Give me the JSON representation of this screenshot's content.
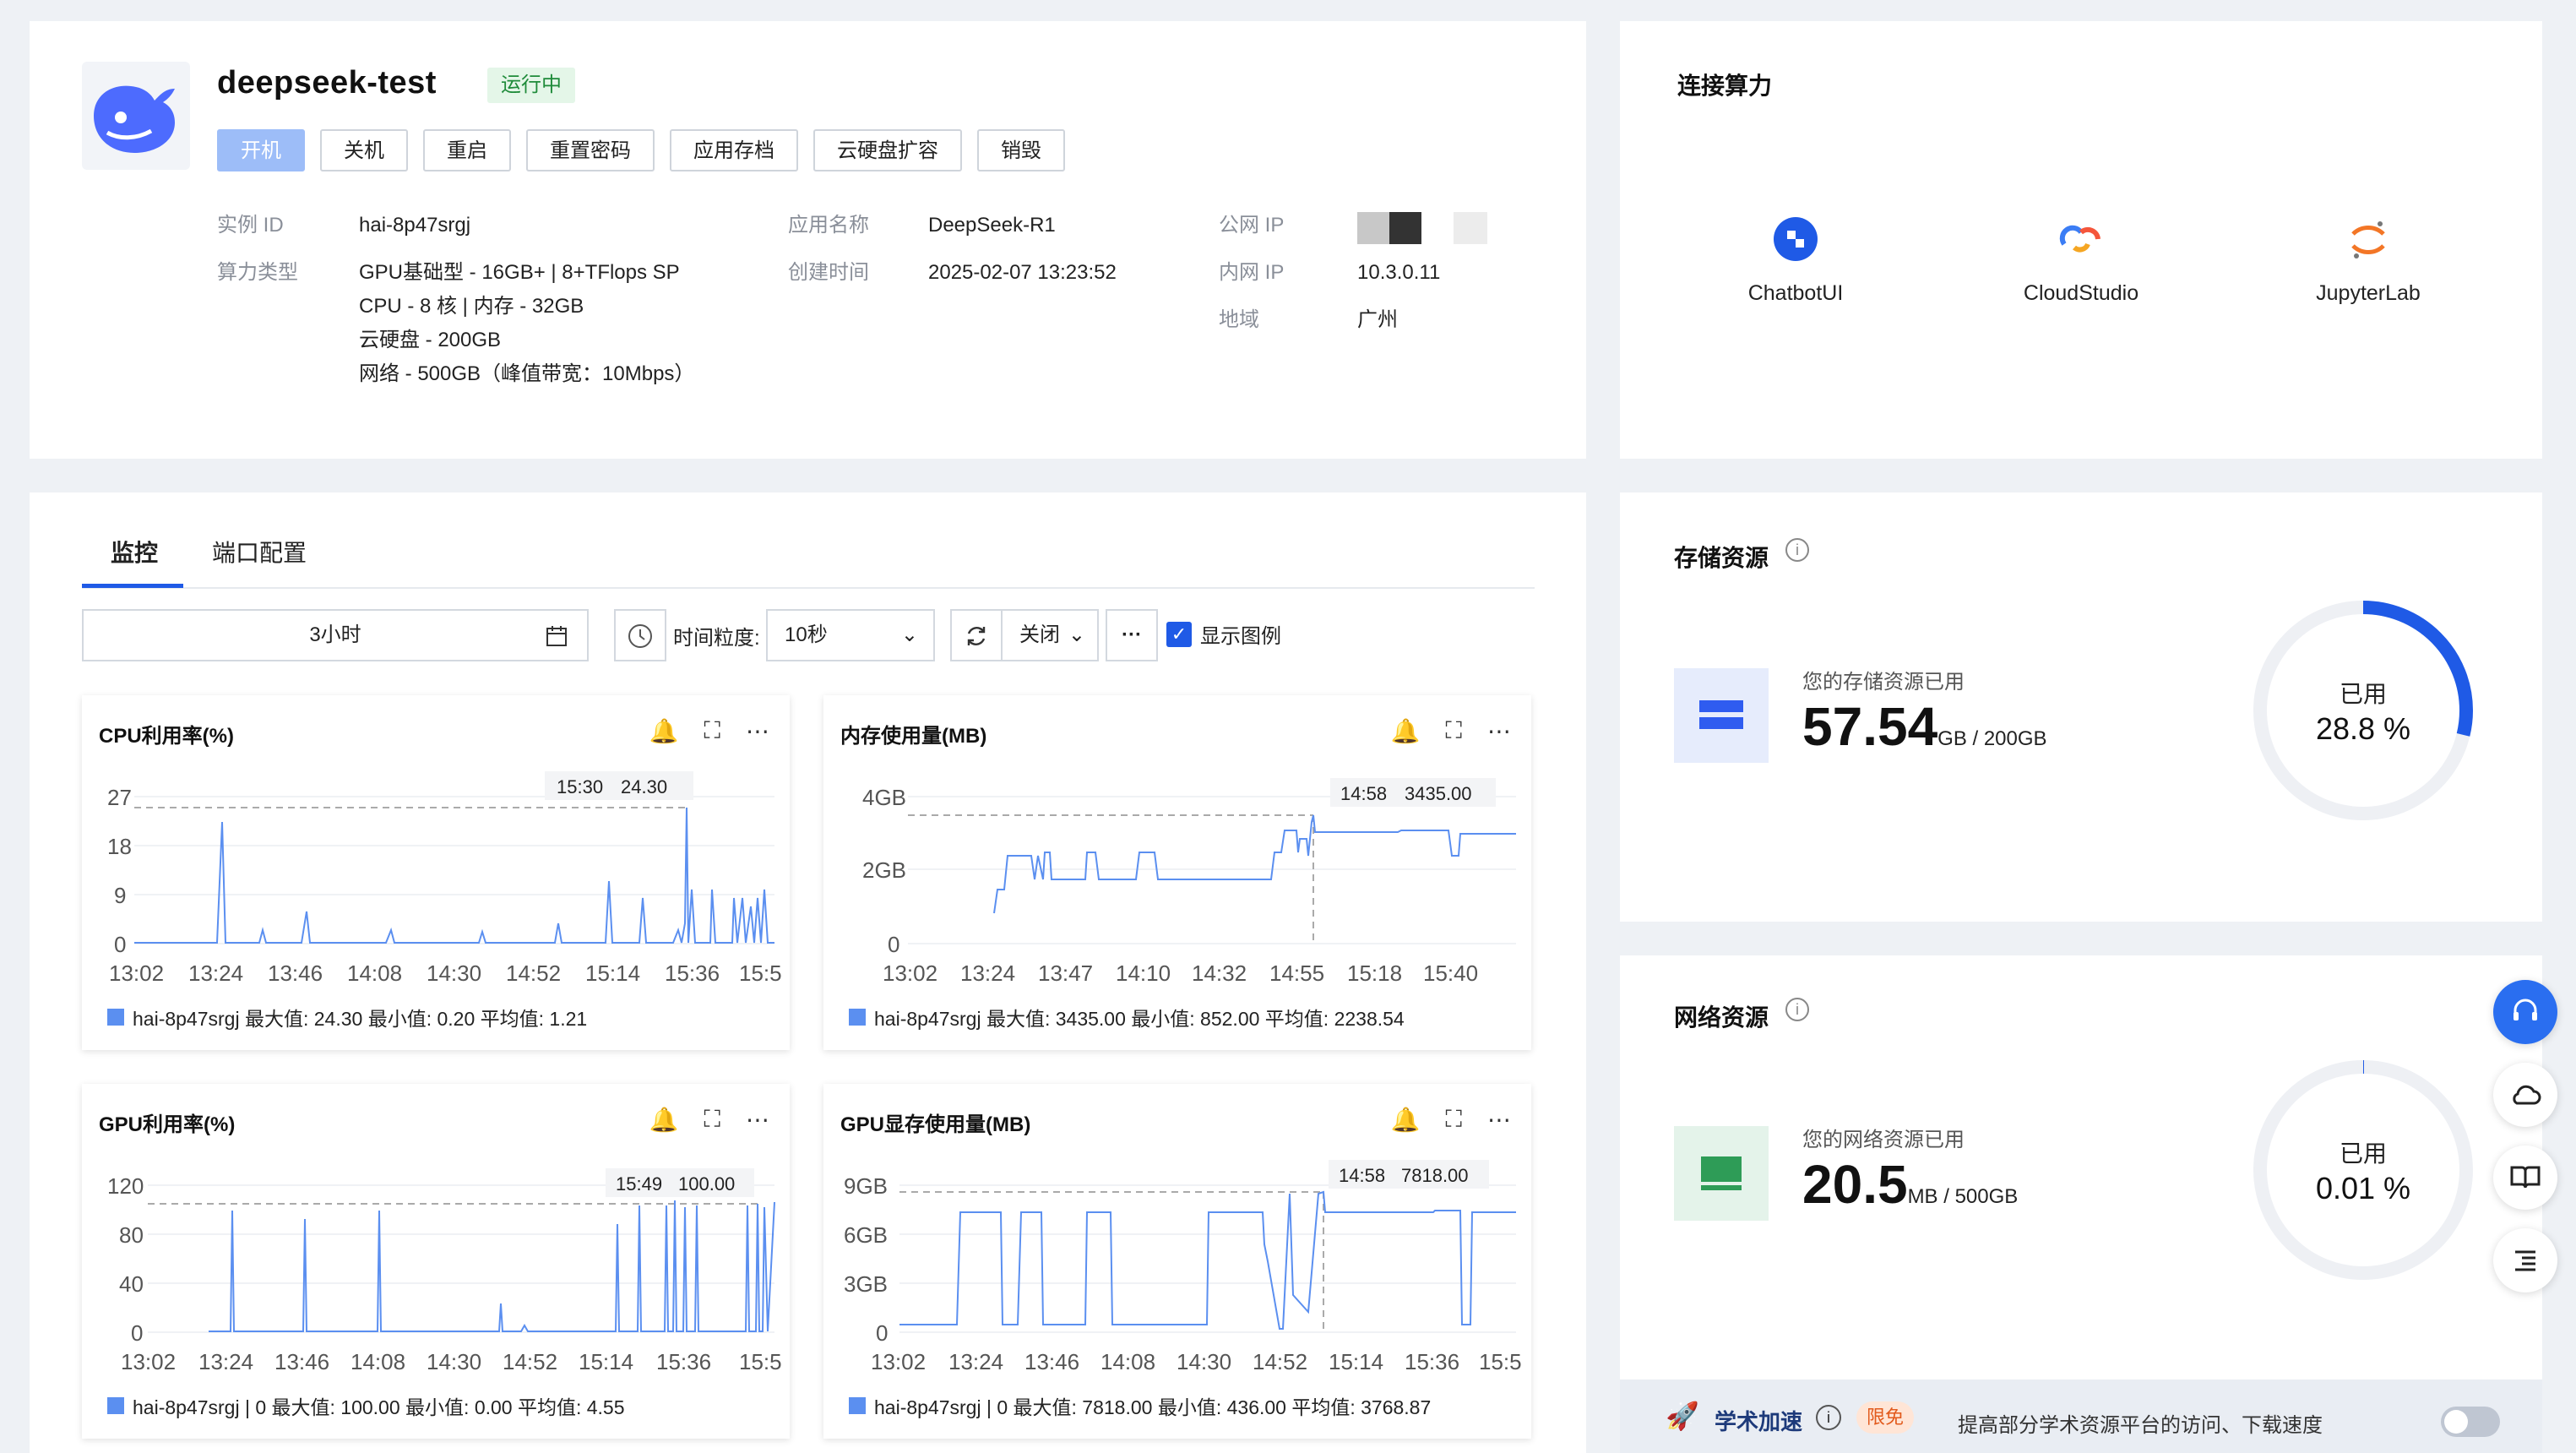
{
  "instance": {
    "name": "deepseek-test",
    "status": "运行中",
    "buttons": [
      "开机",
      "关机",
      "重启",
      "重置密码",
      "应用存档",
      "云硬盘扩容",
      "销毁"
    ],
    "labels": {
      "id": "实例 ID",
      "type": "算力类型",
      "app": "应用名称",
      "created": "创建时间",
      "public_ip": "公网 IP",
      "private_ip": "内网 IP",
      "region": "地域"
    },
    "values": {
      "id": "hai-8p47srgj",
      "type_lines": [
        "GPU基础型 - 16GB+ | 8+TFlops SP",
        "CPU - 8 核 | 内存 - 32GB",
        "云硬盘 - 200GB",
        "网络 - 500GB（峰值带宽：10Mbps）"
      ],
      "app": "DeepSeek-R1",
      "created": "2025-02-07 13:23:52",
      "private_ip": "10.3.0.11",
      "region": "广州"
    }
  },
  "connect": {
    "title": "连接算力",
    "apps": [
      {
        "label": "ChatbotUI",
        "icon": "chatbotui-icon"
      },
      {
        "label": "CloudStudio",
        "icon": "cloudstudio-icon"
      },
      {
        "label": "JupyterLab",
        "icon": "jupyter-icon"
      }
    ]
  },
  "monitor": {
    "tabs": [
      "监控",
      "端口配置"
    ],
    "range": "3小时",
    "granularity_label": "时间粒度:",
    "granularity": "10秒",
    "refresh": "关闭",
    "more": "···",
    "show_legend": "显示图例"
  },
  "charts": [
    {
      "title": "CPU利用率(%)",
      "tooltip_time": "15:30",
      "tooltip_value": "24.30",
      "legend": "hai-8p47srgj  最大值: 24.30  最小值: 0.20  平均值: 1.21",
      "yticks": [
        "27",
        "18",
        "9",
        "0"
      ],
      "xticks": [
        "13:02",
        "13:24",
        "13:46",
        "14:08",
        "14:30",
        "14:52",
        "15:14",
        "15:36",
        "15:5"
      ]
    },
    {
      "title": "内存使用量(MB)",
      "tooltip_time": "14:58",
      "tooltip_value": "3435.00",
      "legend": "hai-8p47srgj  最大值: 3435.00  最小值: 852.00  平均值: 2238.54",
      "yticks": [
        "4GB",
        "2GB",
        "0"
      ],
      "xticks": [
        "13:02",
        "13:24",
        "13:47",
        "14:10",
        "14:32",
        "14:55",
        "15:18",
        "15:40"
      ]
    },
    {
      "title": "GPU利用率(%)",
      "tooltip_time": "15:49",
      "tooltip_value": "100.00",
      "legend": "hai-8p47srgj | 0  最大值: 100.00  最小值: 0.00  平均值: 4.55",
      "yticks": [
        "120",
        "80",
        "40",
        "0"
      ],
      "xticks": [
        "13:02",
        "13:24",
        "13:46",
        "14:08",
        "14:30",
        "14:52",
        "15:14",
        "15:36",
        "15:5"
      ]
    },
    {
      "title": "GPU显存使用量(MB)",
      "tooltip_time": "14:58",
      "tooltip_value": "7818.00",
      "legend": "hai-8p47srgj | 0  最大值: 7818.00  最小值: 436.00  平均值: 3768.87",
      "yticks": [
        "9GB",
        "6GB",
        "3GB",
        "0"
      ],
      "xticks": [
        "13:02",
        "13:24",
        "13:46",
        "14:08",
        "14:30",
        "14:52",
        "15:14",
        "15:36",
        "15:5"
      ]
    }
  ],
  "storage": {
    "title": "存储资源",
    "caption": "您的存储资源已用",
    "value": "57.54",
    "unit": "GB / 200GB",
    "used_label": "已用",
    "percent": "28.8 %",
    "fraction": 0.288
  },
  "network": {
    "title": "网络资源",
    "caption": "您的网络资源已用",
    "value": "20.5",
    "unit": "MB / 500GB",
    "used_label": "已用",
    "percent": "0.01 %",
    "fraction": 0.0001
  },
  "accel": {
    "title": "学术加速",
    "badge": "限免",
    "desc": "提高部分学术资源平台的访问、下载速度"
  },
  "colors": {
    "primary": "#1f5ae6",
    "line": "#5b8ff0",
    "status_green": "#1f8b3a"
  }
}
